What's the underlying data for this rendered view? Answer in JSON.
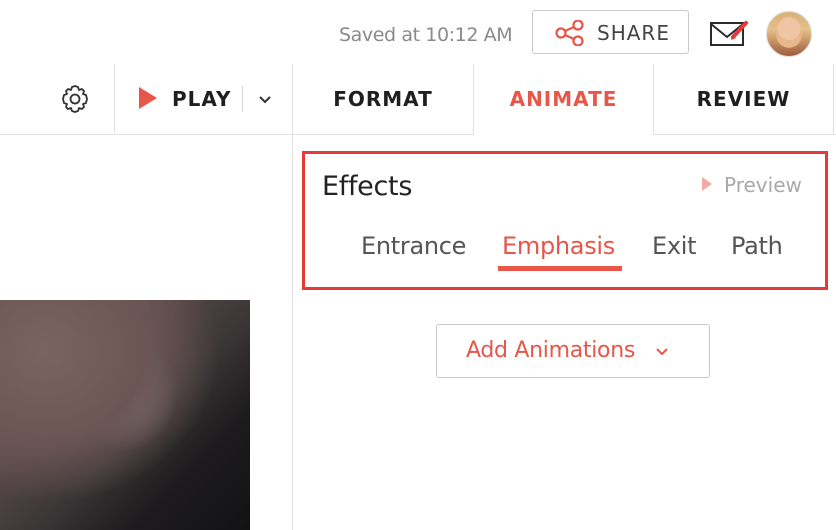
{
  "header": {
    "saved_status": "Saved at 10:12 AM",
    "share_label": "SHARE",
    "share_icon": "share-icon",
    "mail_icon": "envelope-edit-icon",
    "avatar_icon": "user-avatar"
  },
  "toolbar": {
    "settings_icon": "gear-icon",
    "play_label": "PLAY",
    "play_dropdown_icon": "chevron-down-icon",
    "tabs": [
      {
        "label": "FORMAT",
        "active": false
      },
      {
        "label": "ANIMATE",
        "active": true
      },
      {
        "label": "REVIEW",
        "active": false
      }
    ]
  },
  "effects": {
    "title": "Effects",
    "preview_label": "Preview",
    "tabs": [
      {
        "label": "Entrance",
        "active": false
      },
      {
        "label": "Emphasis",
        "active": true
      },
      {
        "label": "Exit",
        "active": false
      },
      {
        "label": "Path",
        "active": false
      }
    ]
  },
  "add_animations": {
    "label": "Add Animations"
  },
  "colors": {
    "accent": "#e8564a",
    "highlight_border": "#e5393b",
    "border": "#c9c9c9",
    "muted_text": "#8a8a8a"
  }
}
